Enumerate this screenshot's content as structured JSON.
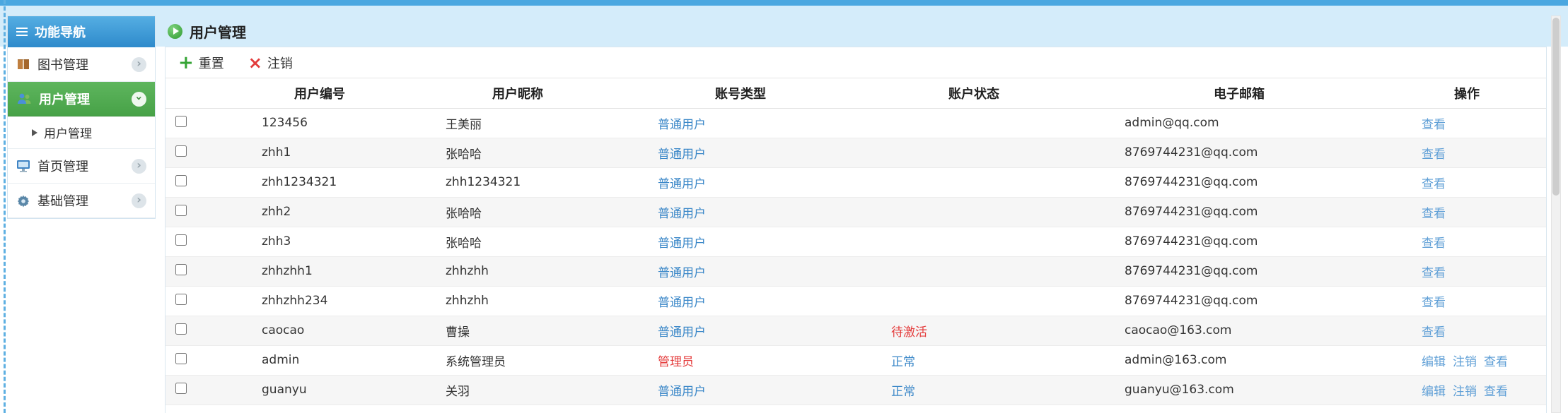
{
  "colors": {
    "accent_blue": "#4aa7e0",
    "band_blue": "#d4ecfa",
    "active_green": "#47a247",
    "link_blue": "#3a87c8",
    "danger_red": "#e43b3b",
    "action_link_blue": "#5f9fd6"
  },
  "icons": {
    "chevron": "›",
    "plus": "+",
    "close": "×"
  },
  "sidebar": {
    "header": {
      "label": "功能导航",
      "icon": "menu-list-icon"
    },
    "items": [
      {
        "label": "图书管理",
        "icon": "book-icon",
        "active": false
      },
      {
        "label": "用户管理",
        "icon": "users-icon",
        "active": true
      },
      {
        "label": "首页管理",
        "icon": "monitor-icon",
        "active": false
      },
      {
        "label": "基础管理",
        "icon": "gear-icon",
        "active": false
      }
    ],
    "subitems": [
      {
        "label": "用户管理",
        "parent": "用户管理"
      }
    ]
  },
  "header": {
    "title": "用户管理"
  },
  "toolbar": {
    "reset_label": "重置",
    "logout_label": "注销"
  },
  "table": {
    "columns": [
      "用户编号",
      "用户昵称",
      "账号类型",
      "账户状态",
      "电子邮箱",
      "操作"
    ],
    "rows": [
      {
        "id": "123456",
        "nickname": "王美丽",
        "type": "普通用户",
        "status": "",
        "email": "admin@qq.com",
        "actions": [
          "查看"
        ]
      },
      {
        "id": "zhh1",
        "nickname": "张哈哈",
        "type": "普通用户",
        "status": "",
        "email": "8769744231@qq.com",
        "actions": [
          "查看"
        ]
      },
      {
        "id": "zhh1234321",
        "nickname": "zhh1234321",
        "type": "普通用户",
        "status": "",
        "email": "8769744231@qq.com",
        "actions": [
          "查看"
        ]
      },
      {
        "id": "zhh2",
        "nickname": "张哈哈",
        "type": "普通用户",
        "status": "",
        "email": "8769744231@qq.com",
        "actions": [
          "查看"
        ]
      },
      {
        "id": "zhh3",
        "nickname": "张哈哈",
        "type": "普通用户",
        "status": "",
        "email": "8769744231@qq.com",
        "actions": [
          "查看"
        ]
      },
      {
        "id": "zhhzhh1",
        "nickname": "zhhzhh",
        "type": "普通用户",
        "status": "",
        "email": "8769744231@qq.com",
        "actions": [
          "查看"
        ]
      },
      {
        "id": "zhhzhh234",
        "nickname": "zhhzhh",
        "type": "普通用户",
        "status": "",
        "email": "8769744231@qq.com",
        "actions": [
          "查看"
        ]
      },
      {
        "id": "caocao",
        "nickname": "曹操",
        "type": "普通用户",
        "status": "待激活",
        "email": "caocao@163.com",
        "actions": [
          "查看"
        ]
      },
      {
        "id": "admin",
        "nickname": "系统管理员",
        "type": "管理员",
        "status": "正常",
        "email": "admin@163.com",
        "actions": [
          "编辑",
          "注销",
          "查看"
        ]
      },
      {
        "id": "guanyu",
        "nickname": "关羽",
        "type": "普通用户",
        "status": "正常",
        "email": "guanyu@163.com",
        "actions": [
          "编辑",
          "注销",
          "查看"
        ]
      }
    ]
  }
}
